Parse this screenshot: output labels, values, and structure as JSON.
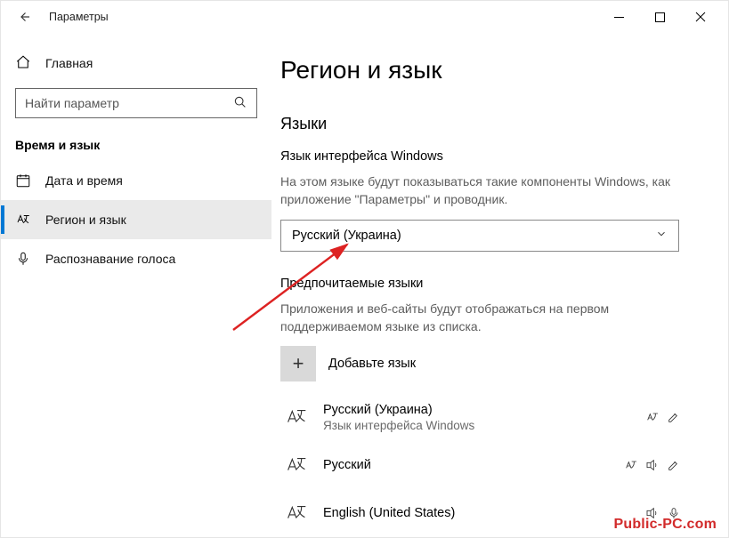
{
  "titlebar": {
    "title": "Параметры"
  },
  "sidebar": {
    "home": "Главная",
    "search_placeholder": "Найти параметр",
    "group": "Время и язык",
    "items": [
      {
        "label": "Дата и время"
      },
      {
        "label": "Регион и язык"
      },
      {
        "label": "Распознавание голоса"
      }
    ]
  },
  "main": {
    "page_title": "Регион и язык",
    "languages_heading": "Языки",
    "display_lang": {
      "title": "Язык интерфейса Windows",
      "desc": "На этом языке будут показываться такие компоненты Windows, как приложение \"Параметры\" и проводник.",
      "value": "Русский (Украина)"
    },
    "preferred": {
      "title": "Предпочитаемые языки",
      "desc": "Приложения и веб-сайты будут отображаться на первом поддерживаемом языке из списка.",
      "add_label": "Добавьте язык"
    },
    "langs": [
      {
        "name": "Русский (Украина)",
        "sub": "Язык интерфейса Windows"
      },
      {
        "name": "Русский",
        "sub": ""
      },
      {
        "name": "English (United States)",
        "sub": ""
      }
    ]
  },
  "watermark": "Public-PC.com"
}
